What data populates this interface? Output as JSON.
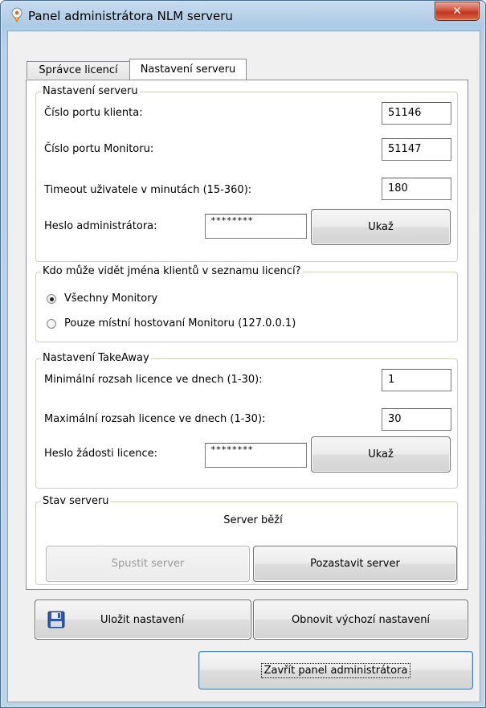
{
  "window": {
    "title": "Panel administrátora NLM serveru",
    "close_symbol": "✕"
  },
  "tabs": [
    {
      "label": "Správce licencí",
      "active": false
    },
    {
      "label": "Nastavení serveru",
      "active": true
    }
  ],
  "server_settings": {
    "legend": "Nastavení serveru",
    "client_port_label": "Číslo portu klienta:",
    "client_port_value": "51146",
    "monitor_port_label": "Číslo portu Monitoru:",
    "monitor_port_value": "51147",
    "timeout_label": "Timeout uživatele v minutách (15-360):",
    "timeout_value": "180",
    "admin_password_label": "Heslo administrátora:",
    "admin_password_value": "********",
    "show_button": "Ukaž"
  },
  "visibility": {
    "legend": "Kdo může vidět jména klientů v seznamu licencí?",
    "options": [
      {
        "label": "Všechny Monitory",
        "checked": true
      },
      {
        "label": "Pouze místní hostovaní Monitoru (127.0.0.1)",
        "checked": false
      }
    ]
  },
  "takeaway": {
    "legend": "Nastavení TakeAway",
    "min_label": "Minimální rozsah licence ve dnech (1-30):",
    "min_value": "1",
    "max_label": "Maximální rozsah licence ve dnech (1-30):",
    "max_value": "30",
    "password_label": "Heslo žádosti licence:",
    "password_value": "********",
    "show_button": "Ukaž"
  },
  "server_status": {
    "legend": "Stav serveru",
    "status_text": "Server běží",
    "start_button": "Spustit server",
    "pause_button": "Pozastavit server"
  },
  "actions": {
    "save_button": "Uložit nastavení",
    "restore_button": "Obnovit výchozí nastavení",
    "close_panel_button": "Zavřít panel administrátora"
  },
  "icons": {
    "app": "rocket-app-icon",
    "save": "floppy-disk-icon"
  },
  "colors": {
    "title_bar": "#b8d2ea",
    "close_button": "#c3361f",
    "panel_background": "#f0f0f0"
  }
}
